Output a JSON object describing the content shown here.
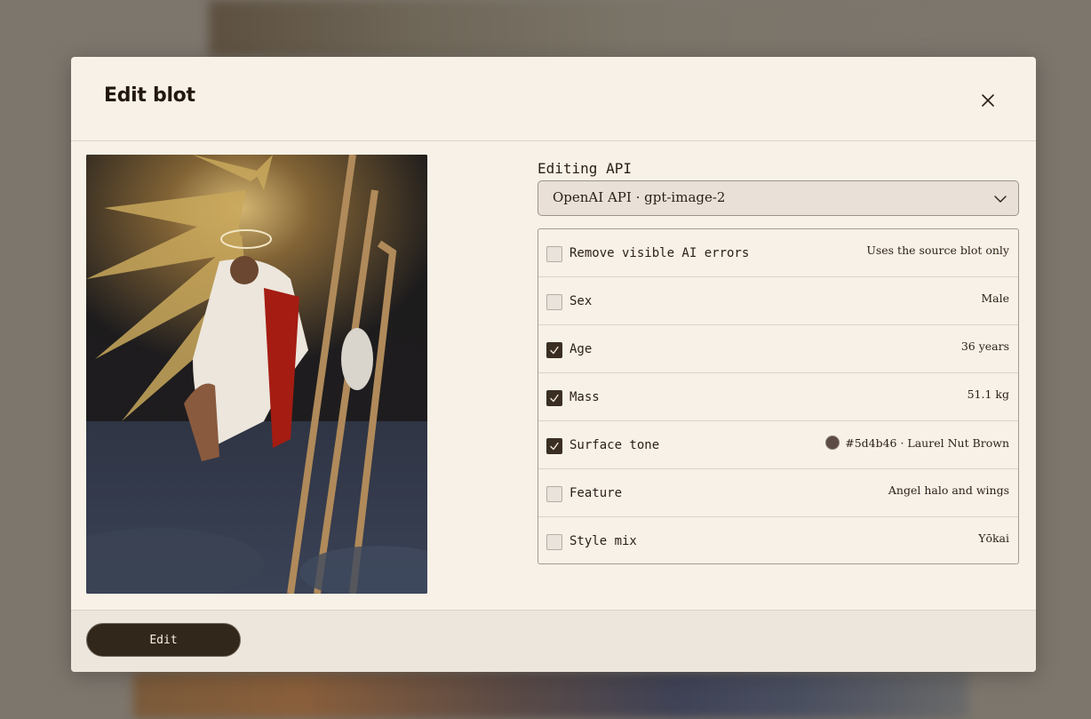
{
  "modal": {
    "title": "Edit blot",
    "close_icon": "close-icon"
  },
  "preview": {
    "description_icon": "blot-preview-image"
  },
  "api": {
    "label": "Editing API",
    "selected": "OpenAI API · gpt-image-2",
    "icon": "chevron-down-icon"
  },
  "options": [
    {
      "label": "Remove visible AI errors",
      "value": "Uses the source blot only",
      "checked": false
    },
    {
      "label": "Sex",
      "value": "Male",
      "checked": false
    },
    {
      "label": "Age",
      "value": "36 years",
      "checked": true
    },
    {
      "label": "Mass",
      "value": "51.1 kg",
      "checked": true
    },
    {
      "label": "Surface tone",
      "value": "#5d4b46 · Laurel Nut Brown",
      "checked": true,
      "swatch": "#5d4b46"
    },
    {
      "label": "Feature",
      "value": "Angel halo and wings",
      "checked": false
    },
    {
      "label": "Style mix",
      "value": "Yōkai",
      "checked": false
    }
  ],
  "footer": {
    "edit_label": "Edit"
  },
  "colors": {
    "modal_bg": "#f8f1e7",
    "button_bg": "#32271b",
    "checkbox_checked": "#3a2e22"
  }
}
